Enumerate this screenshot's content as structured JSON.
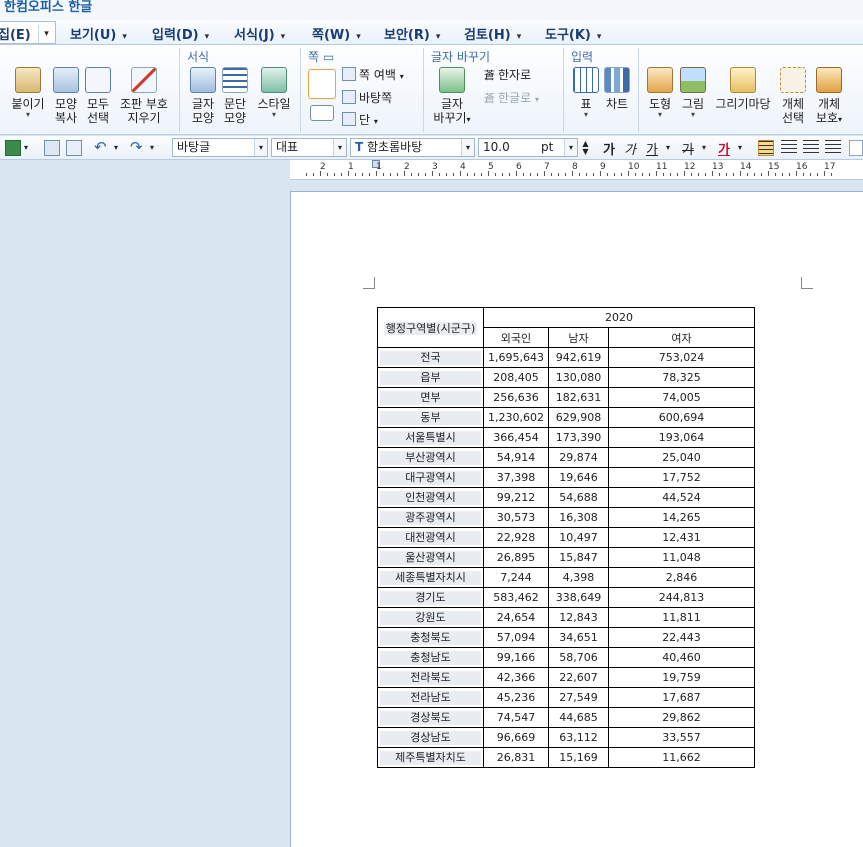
{
  "window": {
    "title": "한컴오피스 한글"
  },
  "menu": [
    {
      "label": "집(E)"
    },
    {
      "label": "보기(U)"
    },
    {
      "label": "입력(D)"
    },
    {
      "label": "서식(J)"
    },
    {
      "label": "쪽(W)"
    },
    {
      "label": "보안(R)"
    },
    {
      "label": "검토(H)"
    },
    {
      "label": "도구(K)"
    }
  ],
  "ribbon": {
    "groups": {
      "format": "서식",
      "page": "쪽",
      "convert": "글자 바꾸기",
      "input": "입력"
    },
    "buttons": {
      "paste": "붙이기",
      "shape_copy_1": "모양",
      "shape_copy_2": "복사",
      "select_all_1": "모두",
      "select_all_2": "선택",
      "clear_1": "조판 부호",
      "clear_2": "지우기",
      "char_shape_1": "글자",
      "char_shape_2": "모양",
      "para_shape_1": "문단",
      "para_shape_2": "모양",
      "style": "스타일",
      "margin": "쪽 여백",
      "background": "바탕쪽",
      "columns": "단",
      "hanja": "한자로",
      "hangul": "한글로",
      "convert_1": "글자",
      "convert_2": "바꾸기",
      "table": "표",
      "chart": "차트",
      "shape": "도형",
      "picture": "그림",
      "drawing": "그리기마당",
      "obj_select_1": "개체",
      "obj_select_2": "선택",
      "obj_protect_1": "개체",
      "obj_protect_2": "보호"
    }
  },
  "format_toolbar": {
    "style": "바탕글",
    "lang": "대표",
    "font": "함초롬바탕",
    "size": "10.0",
    "unit": "pt",
    "bold": "가",
    "italic": "가",
    "underline": "가",
    "strike": "가",
    "color": "가"
  },
  "ruler": {
    "numbers": [
      "2",
      "1",
      "1",
      "2",
      "3",
      "4",
      "5",
      "6",
      "7",
      "8",
      "9",
      "10",
      "11",
      "12",
      "13",
      "14",
      "15",
      "16",
      "17"
    ]
  },
  "table": {
    "row_header_label": "행정구역별(시군구)",
    "year": "2020",
    "columns": [
      "외국인",
      "남자",
      "여자"
    ],
    "rows": [
      {
        "name": "전국",
        "foreign": "1,695,643",
        "male": "942,619",
        "female": "753,024"
      },
      {
        "name": "읍부",
        "foreign": "208,405",
        "male": "130,080",
        "female": "78,325"
      },
      {
        "name": "면부",
        "foreign": "256,636",
        "male": "182,631",
        "female": "74,005"
      },
      {
        "name": "동부",
        "foreign": "1,230,602",
        "male": "629,908",
        "female": "600,694"
      },
      {
        "name": "서울특별시",
        "foreign": "366,454",
        "male": "173,390",
        "female": "193,064"
      },
      {
        "name": "부산광역시",
        "foreign": "54,914",
        "male": "29,874",
        "female": "25,040"
      },
      {
        "name": "대구광역시",
        "foreign": "37,398",
        "male": "19,646",
        "female": "17,752"
      },
      {
        "name": "인천광역시",
        "foreign": "99,212",
        "male": "54,688",
        "female": "44,524"
      },
      {
        "name": "광주광역시",
        "foreign": "30,573",
        "male": "16,308",
        "female": "14,265"
      },
      {
        "name": "대전광역시",
        "foreign": "22,928",
        "male": "10,497",
        "female": "12,431"
      },
      {
        "name": "울산광역시",
        "foreign": "26,895",
        "male": "15,847",
        "female": "11,048"
      },
      {
        "name": "세종특별자치시",
        "foreign": "7,244",
        "male": "4,398",
        "female": "2,846"
      },
      {
        "name": "경기도",
        "foreign": "583,462",
        "male": "338,649",
        "female": "244,813"
      },
      {
        "name": "강원도",
        "foreign": "24,654",
        "male": "12,843",
        "female": "11,811"
      },
      {
        "name": "충청북도",
        "foreign": "57,094",
        "male": "34,651",
        "female": "22,443"
      },
      {
        "name": "충청남도",
        "foreign": "99,166",
        "male": "58,706",
        "female": "40,460"
      },
      {
        "name": "전라북도",
        "foreign": "42,366",
        "male": "22,607",
        "female": "19,759"
      },
      {
        "name": "전라남도",
        "foreign": "45,236",
        "male": "27,549",
        "female": "17,687"
      },
      {
        "name": "경상북도",
        "foreign": "74,547",
        "male": "44,685",
        "female": "29,862"
      },
      {
        "name": "경상남도",
        "foreign": "96,669",
        "male": "63,112",
        "female": "33,557"
      },
      {
        "name": "제주특별자치도",
        "foreign": "26,831",
        "male": "15,169",
        "female": "11,662"
      }
    ]
  },
  "colors": {
    "accent": "#1a5fa8",
    "workspace": "#d9e6f2"
  }
}
